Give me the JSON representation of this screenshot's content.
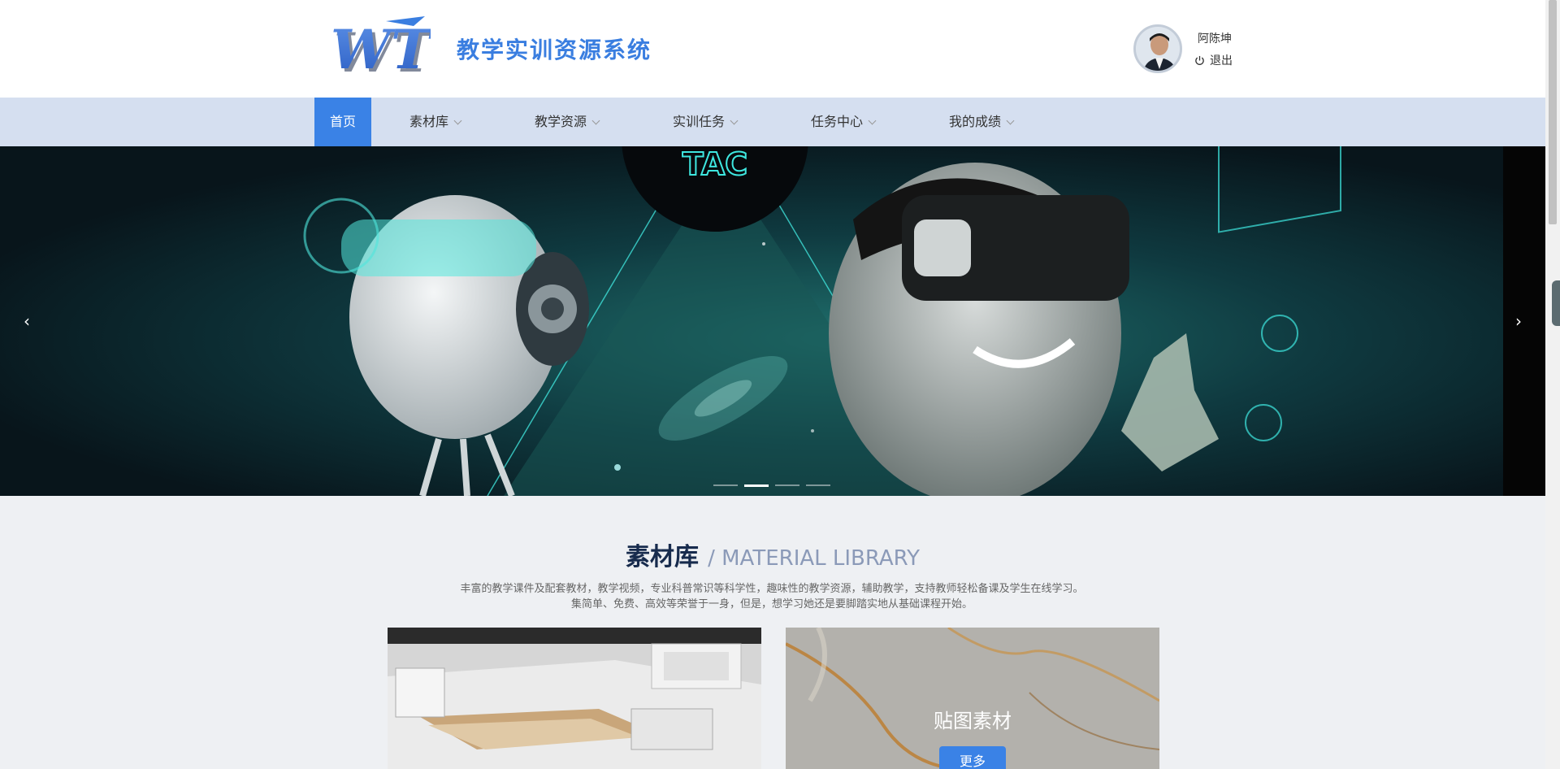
{
  "header": {
    "logo_text": "WT",
    "site_title": "教学实训资源系统",
    "user": {
      "name": "阿陈坤",
      "logout_label": "退出"
    }
  },
  "nav": {
    "items": [
      {
        "label": "首页",
        "active": true
      },
      {
        "label": "素材库",
        "dropdown": true
      },
      {
        "label": "教学资源",
        "dropdown": true
      },
      {
        "label": "实训任务",
        "dropdown": true
      },
      {
        "label": "任务中心",
        "dropdown": true
      },
      {
        "label": "我的成绩",
        "dropdown": true
      }
    ]
  },
  "banner": {
    "prev_icon": "‹",
    "next_icon": "›",
    "slides_count": 4,
    "active_slide": 2,
    "badge_text": "TAC"
  },
  "section": {
    "title_cn": "素材库",
    "title_en": "/ MATERIAL LIBRARY",
    "description": "丰富的教学课件及配套教材，教学视频，专业科普常识等科学性，趣味性的教学资源，辅助教学，支持教师轻松备课及学生在线学习。 集简单、免费、高效等荣誉于一身，但是，想学习她还是要脚踏实地从基础课程开始。",
    "cards": [
      {
        "label": ""
      },
      {
        "label": "贴图素材",
        "button": "更多"
      }
    ]
  },
  "colors": {
    "accent": "#3a82e6",
    "nav_bg": "#d5dff0",
    "title_blue": "#3a7ee0",
    "page_bg": "#eef0f3"
  }
}
